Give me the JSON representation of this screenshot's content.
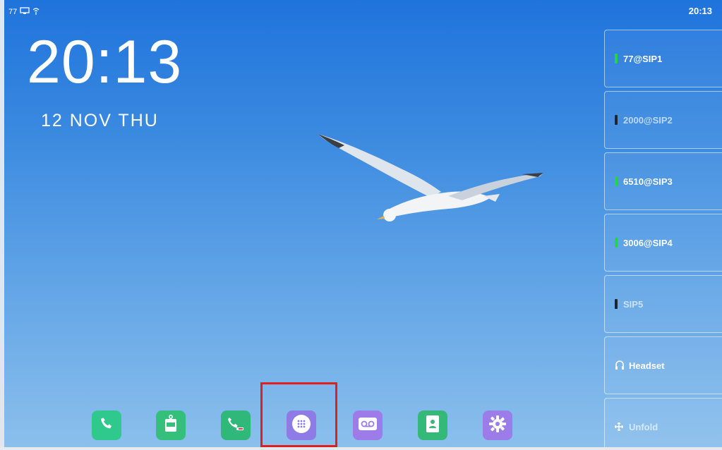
{
  "status_bar": {
    "account_number": "77",
    "time": "20:13"
  },
  "clock": {
    "time": "20:13",
    "date": "12 NOV THU"
  },
  "accounts": [
    {
      "label": "77@SIP1",
      "status_color": "#27d14a",
      "dim": false
    },
    {
      "label": "2000@SIP2",
      "status_color": "#1d2530",
      "dim": true
    },
    {
      "label": "6510@SIP3",
      "status_color": "#27d14a",
      "dim": false
    },
    {
      "label": "3006@SIP4",
      "status_color": "#27d14a",
      "dim": false
    },
    {
      "label": "SIP5",
      "status_color": "#1d2530",
      "dim": true
    }
  ],
  "headset": {
    "label": "Headset",
    "icon": "headset-icon"
  },
  "unfold": {
    "label": "Unfold",
    "icon": "unfold-icon"
  },
  "dock": [
    {
      "name": "phone",
      "icon": "phone-icon",
      "color": "#2fc98d"
    },
    {
      "name": "sms",
      "icon": "sms-icon",
      "color": "#34c07b",
      "badge": "SMS"
    },
    {
      "name": "call-log",
      "icon": "call-log-icon",
      "color": "#2fb87a"
    },
    {
      "name": "apps",
      "icon": "apps-grid-icon",
      "color": "#8f7be6"
    },
    {
      "name": "voicemail",
      "icon": "voicemail-icon",
      "color": "#9d7be9"
    },
    {
      "name": "contacts",
      "icon": "contacts-icon",
      "color": "#35b978"
    },
    {
      "name": "settings",
      "icon": "settings-gear-icon",
      "color": "#9b7ce8"
    }
  ],
  "highlight_target": "apps"
}
